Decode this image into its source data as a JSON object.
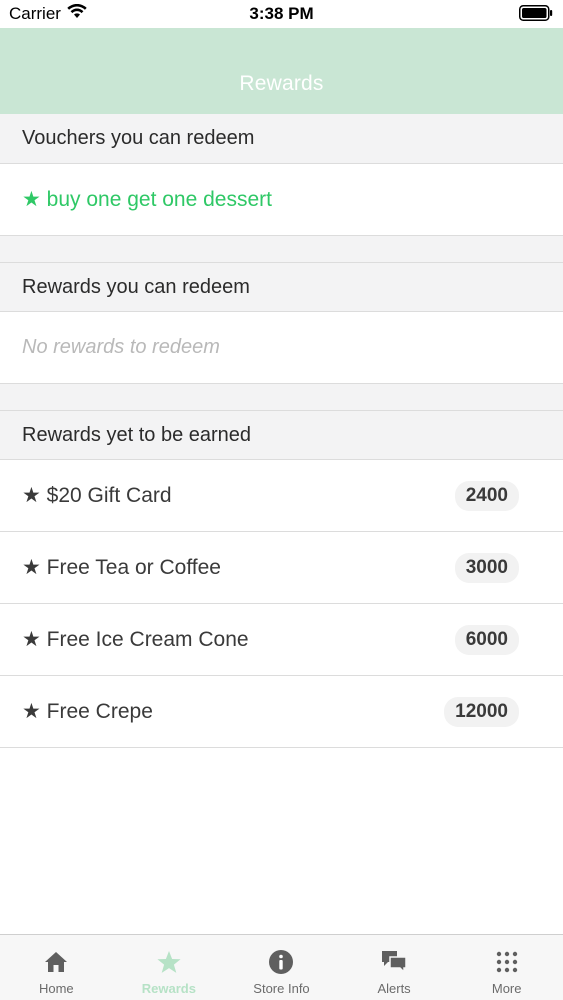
{
  "status_bar": {
    "carrier": "Carrier",
    "time": "3:38 PM"
  },
  "nav": {
    "title": "Rewards"
  },
  "sections": {
    "vouchers": {
      "title": "Vouchers you can redeem",
      "items": [
        {
          "label": "★ buy one get one dessert"
        }
      ]
    },
    "rewards": {
      "title": "Rewards you can redeem",
      "empty": "No rewards to redeem"
    },
    "yet_to_earn": {
      "title": "Rewards yet to be earned",
      "items": [
        {
          "label": "★ $20 Gift Card",
          "points": "2400"
        },
        {
          "label": "★ Free Tea or Coffee",
          "points": "3000"
        },
        {
          "label": "★ Free Ice Cream Cone",
          "points": "6000"
        },
        {
          "label": "★ Free Crepe",
          "points": "12000"
        }
      ]
    }
  },
  "tabs": [
    {
      "label": "Home",
      "icon": "home-icon"
    },
    {
      "label": "Rewards",
      "icon": "star-icon",
      "active": true
    },
    {
      "label": "Store Info",
      "icon": "info-icon"
    },
    {
      "label": "Alerts",
      "icon": "chat-bubbles-icon"
    },
    {
      "label": "More",
      "icon": "grid-dots-icon"
    }
  ],
  "colors": {
    "nav_bg": "#c9e6d4",
    "voucher_green": "#2fc866",
    "tab_active": "#b6e2c6"
  }
}
